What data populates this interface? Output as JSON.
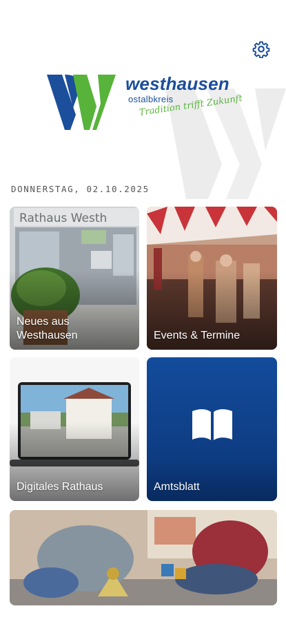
{
  "header": {
    "settings_icon": "gear-icon"
  },
  "brand": {
    "name": "westhausen",
    "subtitle": "ostalbkreis",
    "tagline": "Tradition trifft Zukunft",
    "colors": {
      "blue": "#1b4e9b",
      "green": "#58b33a",
      "watermark": "#ececec"
    }
  },
  "date": "DONNERSTAG, 02.10.2025",
  "tiles": [
    {
      "id": "news",
      "label": "Neues aus\nWesthausen"
    },
    {
      "id": "events",
      "label": "Events & Termine"
    },
    {
      "id": "rathaus",
      "label": "Digitales Rathaus"
    },
    {
      "id": "amtsblatt",
      "label": "Amtsblatt",
      "icon": "open-book-icon"
    },
    {
      "id": "kids"
    }
  ],
  "photo_text": {
    "rathaus_sign": "Rathaus Westh"
  }
}
